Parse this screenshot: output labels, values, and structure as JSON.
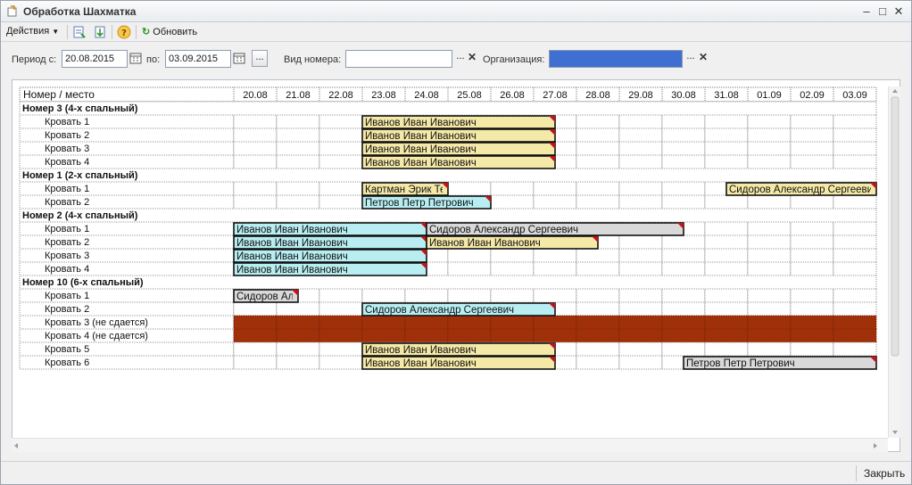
{
  "window": {
    "title": "Обработка  Шахматка"
  },
  "toolbar": {
    "actions_label": "Действия",
    "refresh_label": "Обновить"
  },
  "filters": {
    "period_from_label": "Период с:",
    "period_from_value": "20.08.2015",
    "period_to_label": "по:",
    "period_to_value": "03.09.2015",
    "ellipsis": "...",
    "room_type_label": "Вид номера:",
    "room_type_value": "",
    "organization_label": "Организация:",
    "organization_value": ""
  },
  "grid": {
    "header": "Номер / место",
    "dates": [
      "20.08",
      "21.08",
      "22.08",
      "23.08",
      "24.08",
      "25.08",
      "26.08",
      "27.08",
      "28.08",
      "29.08",
      "30.08",
      "31.08",
      "01.09",
      "02.09",
      "03.09"
    ],
    "rows": [
      {
        "kind": "group",
        "label": "Номер 3 (4-х спальный)"
      },
      {
        "kind": "bed",
        "label": "Кровать 1"
      },
      {
        "kind": "bed",
        "label": "Кровать 2"
      },
      {
        "kind": "bed",
        "label": "Кровать 3"
      },
      {
        "kind": "bed",
        "label": "Кровать 4"
      },
      {
        "kind": "group",
        "label": "Номер 1 (2-х спальный)"
      },
      {
        "kind": "bed",
        "label": "Кровать 1"
      },
      {
        "kind": "bed",
        "label": "Кровать 2"
      },
      {
        "kind": "group",
        "label": "Номер 2 (4-х спальный)"
      },
      {
        "kind": "bed",
        "label": "Кровать 1"
      },
      {
        "kind": "bed",
        "label": "Кровать 2"
      },
      {
        "kind": "bed",
        "label": "Кровать 3"
      },
      {
        "kind": "bed",
        "label": "Кровать 4"
      },
      {
        "kind": "group",
        "label": "Номер 10 (6-х спальный)"
      },
      {
        "kind": "bed",
        "label": "Кровать 1"
      },
      {
        "kind": "bed",
        "label": "Кровать 2"
      },
      {
        "kind": "blocked",
        "label": "Кровать 3 (не сдается)"
      },
      {
        "kind": "blocked",
        "label": "Кровать 4 (не сдается)"
      },
      {
        "kind": "bed",
        "label": "Кровать 5"
      },
      {
        "kind": "bed",
        "label": "Кровать 6"
      }
    ],
    "bookings": [
      {
        "row": 1,
        "start": 3,
        "end": 7.5,
        "text": "Иванов Иван Иванович",
        "color": "yellow"
      },
      {
        "row": 2,
        "start": 3,
        "end": 7.5,
        "text": "Иванов Иван Иванович",
        "color": "yellow"
      },
      {
        "row": 3,
        "start": 3,
        "end": 7.5,
        "text": "Иванов Иван Иванович",
        "color": "yellow"
      },
      {
        "row": 4,
        "start": 3,
        "end": 7.5,
        "text": "Иванов Иван Иванович",
        "color": "yellow"
      },
      {
        "row": 6,
        "start": 3,
        "end": 5,
        "text": "Картман Эрик Тео",
        "color": "yellow"
      },
      {
        "row": 6,
        "start": 11.5,
        "end": 15,
        "text": "Сидоров Александр Сергеевич",
        "color": "yellow"
      },
      {
        "row": 7,
        "start": 3,
        "end": 6,
        "text": "Петров Петр Петрович",
        "color": "cyan"
      },
      {
        "row": 9,
        "start": 0,
        "end": 4.5,
        "text": "Иванов Иван Иванович",
        "color": "cyan"
      },
      {
        "row": 9,
        "start": 4.5,
        "end": 10.5,
        "text": "Сидоров Александр Сергеевич",
        "color": "gray"
      },
      {
        "row": 10,
        "start": 0,
        "end": 4.5,
        "text": "Иванов Иван Иванович",
        "color": "cyan"
      },
      {
        "row": 10,
        "start": 4.5,
        "end": 8.5,
        "text": "Иванов Иван Иванович",
        "color": "yellow"
      },
      {
        "row": 11,
        "start": 0,
        "end": 4.5,
        "text": "Иванов Иван Иванович",
        "color": "cyan"
      },
      {
        "row": 12,
        "start": 0,
        "end": 4.5,
        "text": "Иванов Иван Иванович",
        "color": "cyan"
      },
      {
        "row": 14,
        "start": 0,
        "end": 1.5,
        "text": "Сидоров Але",
        "color": "gray"
      },
      {
        "row": 15,
        "start": 3,
        "end": 7.5,
        "text": "Сидоров Александр Сергеевич",
        "color": "cyan"
      },
      {
        "row": 18,
        "start": 3,
        "end": 7.5,
        "text": "Иванов Иван Иванович",
        "color": "yellow"
      },
      {
        "row": 19,
        "start": 3,
        "end": 7.5,
        "text": "Иванов Иван Иванович",
        "color": "yellow"
      },
      {
        "row": 19,
        "start": 10.5,
        "end": 15,
        "text": "Петров Петр Петрович",
        "color": "gray"
      }
    ]
  },
  "colors": {
    "yellow": "#f5e9a8",
    "cyan": "#b8eef2",
    "gray": "#d9d9d9",
    "blocked": "#a0300a",
    "org_fill": "#3f6fd1",
    "group_bg": "#ffffff"
  },
  "footer": {
    "close_label": "Закрыть"
  }
}
